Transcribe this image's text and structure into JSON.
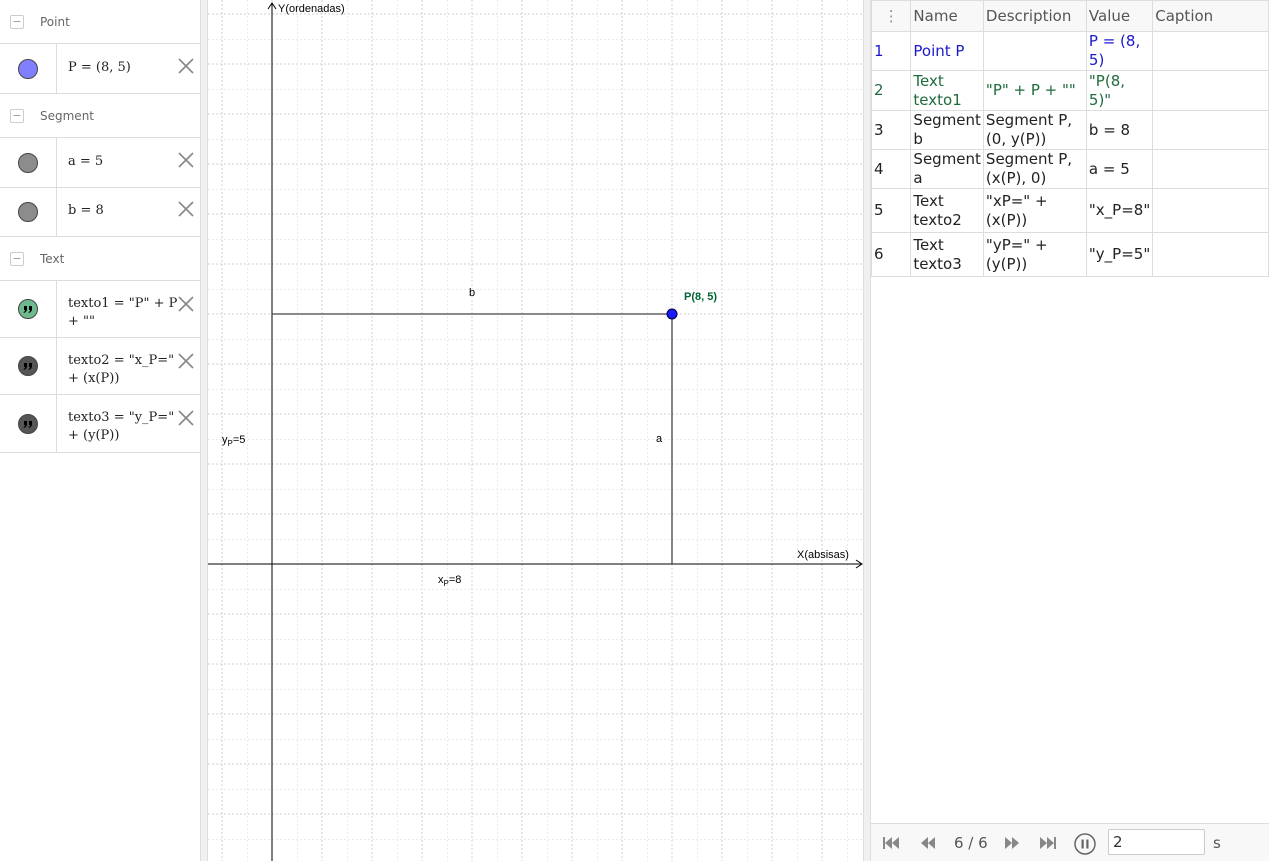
{
  "algebra": {
    "groups": [
      {
        "label": "Point",
        "toggle": "−"
      },
      {
        "label": "Segment",
        "toggle": "−"
      },
      {
        "label": "Text",
        "toggle": "−"
      }
    ],
    "items": [
      {
        "text": "P = (8, 5)",
        "color": "#8080ff"
      },
      {
        "text": "a = 5",
        "color": "#8c8c8c"
      },
      {
        "text": "b = 8",
        "color": "#8c8c8c"
      },
      {
        "text": "texto1 = \"P\" + P + \"\"",
        "color": "#6fb98f"
      },
      {
        "text": "texto2 = \"x_P=\" + (x(P))",
        "color": "#555555"
      },
      {
        "text": "texto3 = \"y_P=\" + (y(P))",
        "color": "#555555"
      }
    ]
  },
  "graphics": {
    "axes": {
      "x_label": "X(absisas)",
      "y_label": "Y(ordenadas)",
      "grid": true
    },
    "point": {
      "name": "P",
      "x": 8,
      "y": 5,
      "label": "P(8, 5)",
      "color": "#1a1aff",
      "label_color": "#006633"
    },
    "segment_b_label": "b",
    "segment_a_label": "a",
    "texto2": {
      "main": "x",
      "sub": "P",
      "rest": "=8"
    },
    "texto3": {
      "main": "y",
      "sub": "P",
      "rest": "=5"
    }
  },
  "protocol": {
    "headers": [
      "",
      "Name",
      "Description",
      "Value",
      "Caption"
    ],
    "rows": [
      {
        "num": "1",
        "name": "Point P",
        "description": "",
        "value": "P = (8, 5)",
        "caption": "",
        "color": "#1a1acc"
      },
      {
        "num": "2",
        "name": "Text texto1",
        "description": "\"P\" + P + \"\"",
        "value": "\"P(8, 5)\"",
        "caption": "",
        "color": "#1e6b3c"
      },
      {
        "num": "3",
        "name": "Segment b",
        "description": "Segment P, (0, y(P))",
        "value": "b = 8",
        "caption": "",
        "color": "#222222"
      },
      {
        "num": "4",
        "name": "Segment a",
        "description": "Segment P, (x(P), 0)",
        "value": "a = 5",
        "caption": "",
        "color": "#222222"
      },
      {
        "num": "5",
        "name": "Text texto2",
        "description": "\"xP=\" + (x(P))",
        "value": "\"x_P=8\"",
        "caption": "",
        "color": "#222222"
      },
      {
        "num": "6",
        "name": "Text texto3",
        "description": "\"yP=\" + (y(P))",
        "value": "\"y_P=5\"",
        "caption": "",
        "color": "#222222"
      }
    ],
    "playbar": {
      "counter": "6 / 6",
      "speed": "2",
      "unit": "s"
    }
  }
}
